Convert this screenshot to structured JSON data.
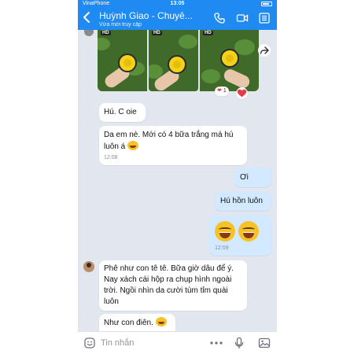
{
  "status_bar": {
    "carrier": "VinaPhone",
    "time": "13:05"
  },
  "header": {
    "title": "Huỳnh Giao - Chuyê...",
    "subtitle": "Vừa mới truy cập"
  },
  "photo_message": {
    "badges": [
      "HD",
      "HD",
      "HD"
    ],
    "reaction_count": "1"
  },
  "messages": [
    {
      "id": "m1",
      "direction": "incoming",
      "text": "Hú. C oie"
    },
    {
      "id": "m2",
      "direction": "incoming",
      "text": "Da em nè. Mới có 4 bữa trắng má hú luôn á",
      "time": "12:08"
    },
    {
      "id": "m3",
      "direction": "outgoing",
      "text": "Ơi"
    },
    {
      "id": "m4",
      "direction": "outgoing",
      "text": "Hú hồn luôn"
    },
    {
      "id": "m5",
      "direction": "outgoing",
      "text": "",
      "time": "12:09"
    },
    {
      "id": "m6",
      "direction": "incoming",
      "text": "Phê như con tê tê. Bữa giờ dâu để ý. Nay xách cái hộp ra chụp hình ngoài trời. Ngồi nhìn da cười tùm tỉm quài luôn"
    },
    {
      "id": "m7",
      "direction": "incoming",
      "text": "Như con điên."
    }
  ],
  "input_bar": {
    "placeholder": "Tin nhắn"
  },
  "colors": {
    "header": "#1f8bf2",
    "chat_bg": "#e2e7ef",
    "incoming_bubble": "#ffffff",
    "outgoing_bubble": "#d2e9ff"
  }
}
